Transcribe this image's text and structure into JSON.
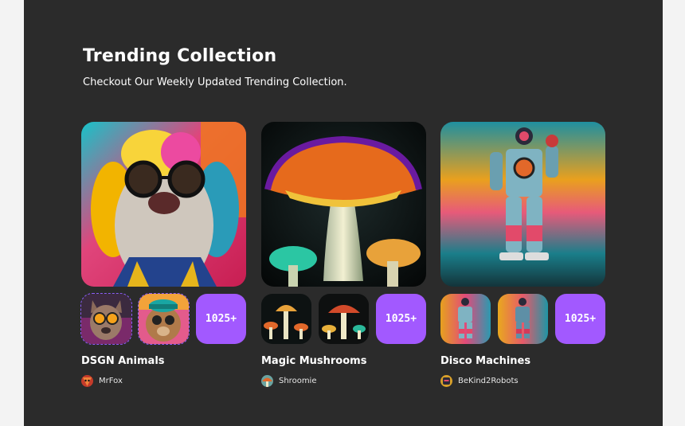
{
  "section": {
    "title": "Trending Collection",
    "subtitle": "Checkout Our Weekly Updated Trending Collection."
  },
  "collections": [
    {
      "name": "DSGN Animals",
      "artist": "MrFox",
      "more_count": "1025+",
      "hero_icon": "dog-with-glasses-image",
      "thumbs": [
        "cat-with-goggles-image",
        "bear-with-sunglasses-image"
      ],
      "avatar_icon": "fox-avatar-icon"
    },
    {
      "name": "Magic Mushrooms",
      "artist": "Shroomie",
      "more_count": "1025+",
      "hero_icon": "glowing-mushroom-image",
      "thumbs": [
        "mushroom-cluster-image",
        "mushroom-cluster-image"
      ],
      "avatar_icon": "mushroom-avatar-icon"
    },
    {
      "name": "Disco Machines",
      "artist": "BeKind2Robots",
      "more_count": "1025+",
      "hero_icon": "robot-on-skates-image",
      "thumbs": [
        "robot-image",
        "robot-image"
      ],
      "avatar_icon": "robot-avatar-icon"
    }
  ],
  "colors": {
    "panel_bg": "#2b2b2b",
    "page_bg": "#f3f3f3",
    "accent": "#a259ff",
    "text": "#ffffff"
  }
}
